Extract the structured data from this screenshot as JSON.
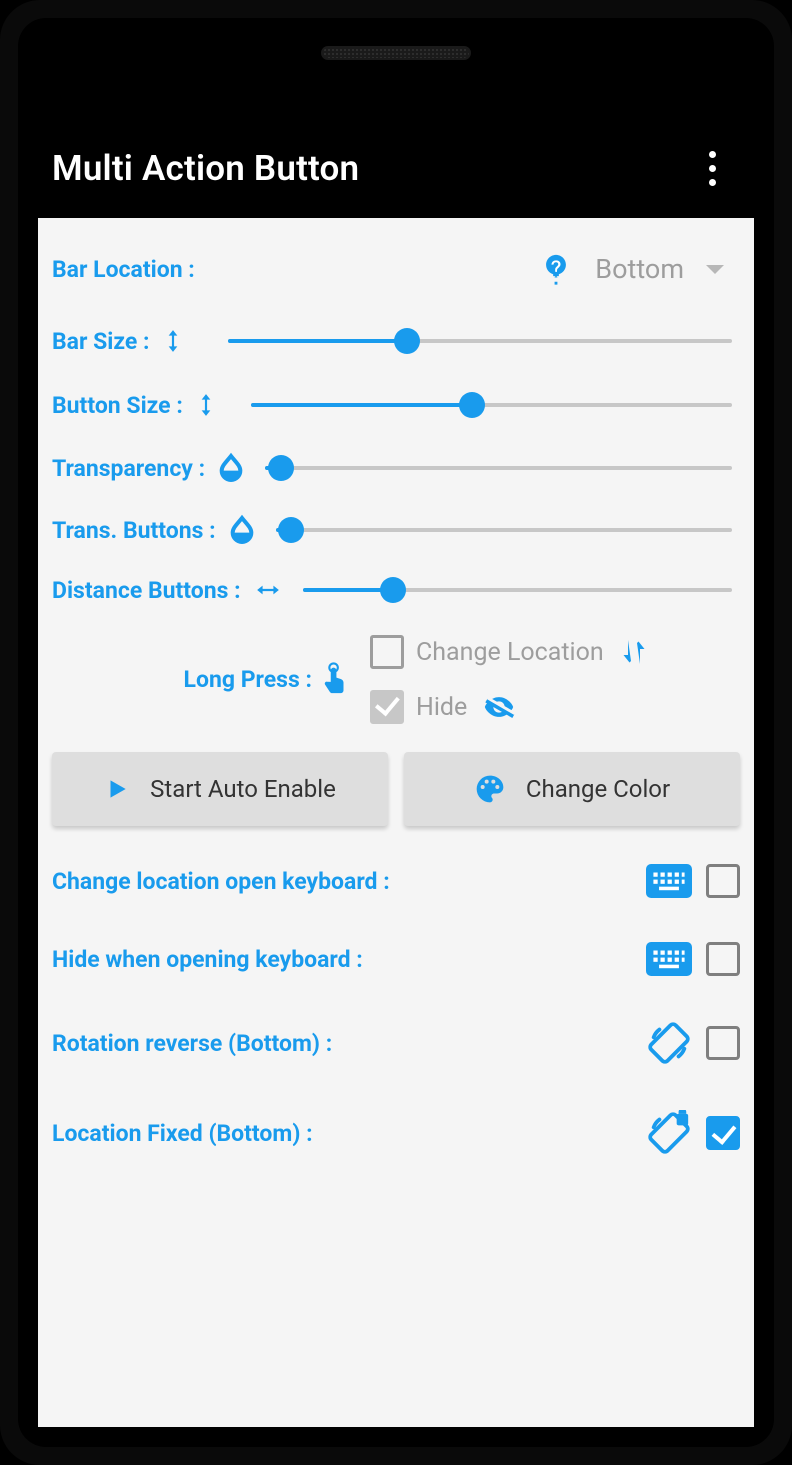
{
  "appTitle": "Multi Action Button",
  "barLocation": {
    "label": "Bar Location :",
    "value": "Bottom"
  },
  "sliders": {
    "barSize": {
      "label": "Bar Size :",
      "pct": 36
    },
    "buttonSize": {
      "label": "Button Size :",
      "pct": 46
    },
    "transparency": {
      "label": "Transparency :",
      "pct": 5
    },
    "transButtons": {
      "label": "Trans. Buttons :",
      "pct": 5
    },
    "distanceButtons": {
      "label": "Distance Buttons :",
      "pct": 22
    }
  },
  "longPress": {
    "label": "Long Press :",
    "changeLocation": {
      "label": "Change Location",
      "checked": false
    },
    "hide": {
      "label": "Hide",
      "checked": true
    }
  },
  "buttons": {
    "startAuto": "Start Auto Enable",
    "changeColor": "Change Color"
  },
  "options": {
    "changeLocKbd": {
      "label": "Change location open keyboard :",
      "checked": false
    },
    "hideKbd": {
      "label": "Hide when opening keyboard :",
      "checked": false
    },
    "rotationRev": {
      "label": "Rotation reverse (Bottom) :",
      "checked": false
    },
    "locFixed": {
      "label": "Location Fixed (Bottom) :",
      "checked": true
    }
  },
  "colors": {
    "accent": "#199bed"
  }
}
